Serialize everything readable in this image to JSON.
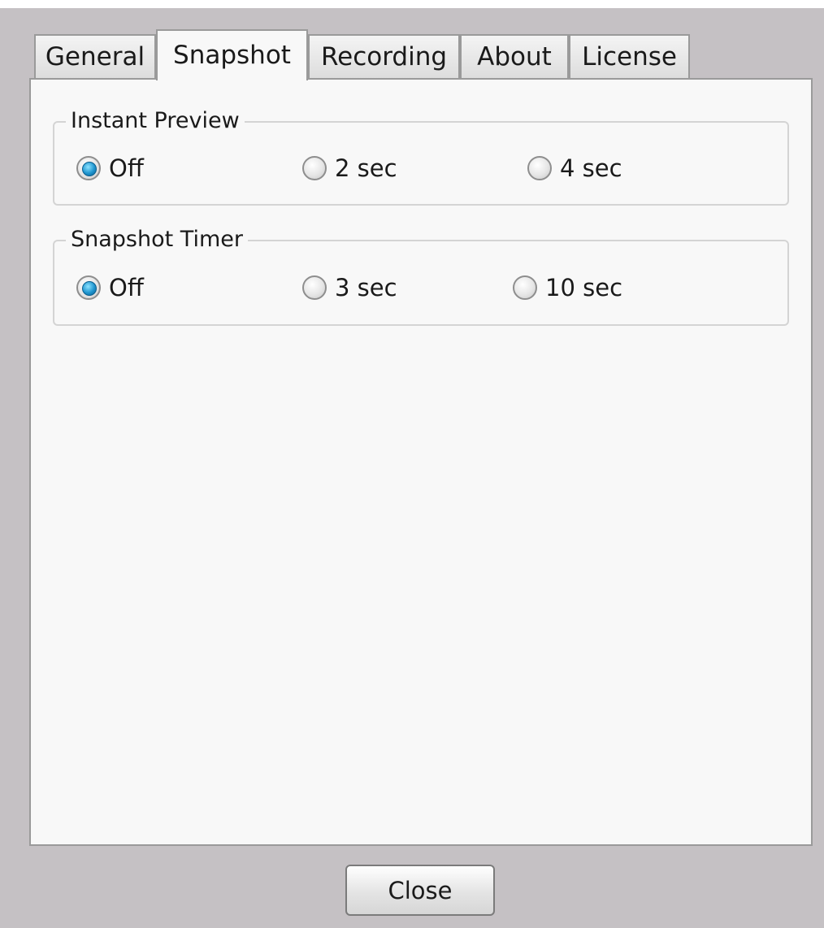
{
  "tabs": [
    {
      "label": "General",
      "active": false
    },
    {
      "label": "Snapshot",
      "active": true
    },
    {
      "label": "Recording",
      "active": false
    },
    {
      "label": "About",
      "active": false
    },
    {
      "label": "License",
      "active": false
    }
  ],
  "instant_preview": {
    "title": "Instant Preview",
    "options": [
      {
        "label": "Off",
        "checked": true
      },
      {
        "label": "2 sec",
        "checked": false
      },
      {
        "label": "4 sec",
        "checked": false
      }
    ]
  },
  "snapshot_timer": {
    "title": "Snapshot Timer",
    "options": [
      {
        "label": "Off",
        "checked": true
      },
      {
        "label": "3 sec",
        "checked": false
      },
      {
        "label": "10 sec",
        "checked": false
      }
    ]
  },
  "footer": {
    "close_label": "Close"
  },
  "colors": {
    "selected_radio": "#1f95cf",
    "window_background": "#c5c1c4",
    "panel_background": "#f8f8f8"
  },
  "icons": {
    "radio_checked": "radio-checked-icon",
    "radio_unchecked": "radio-unchecked-icon"
  }
}
